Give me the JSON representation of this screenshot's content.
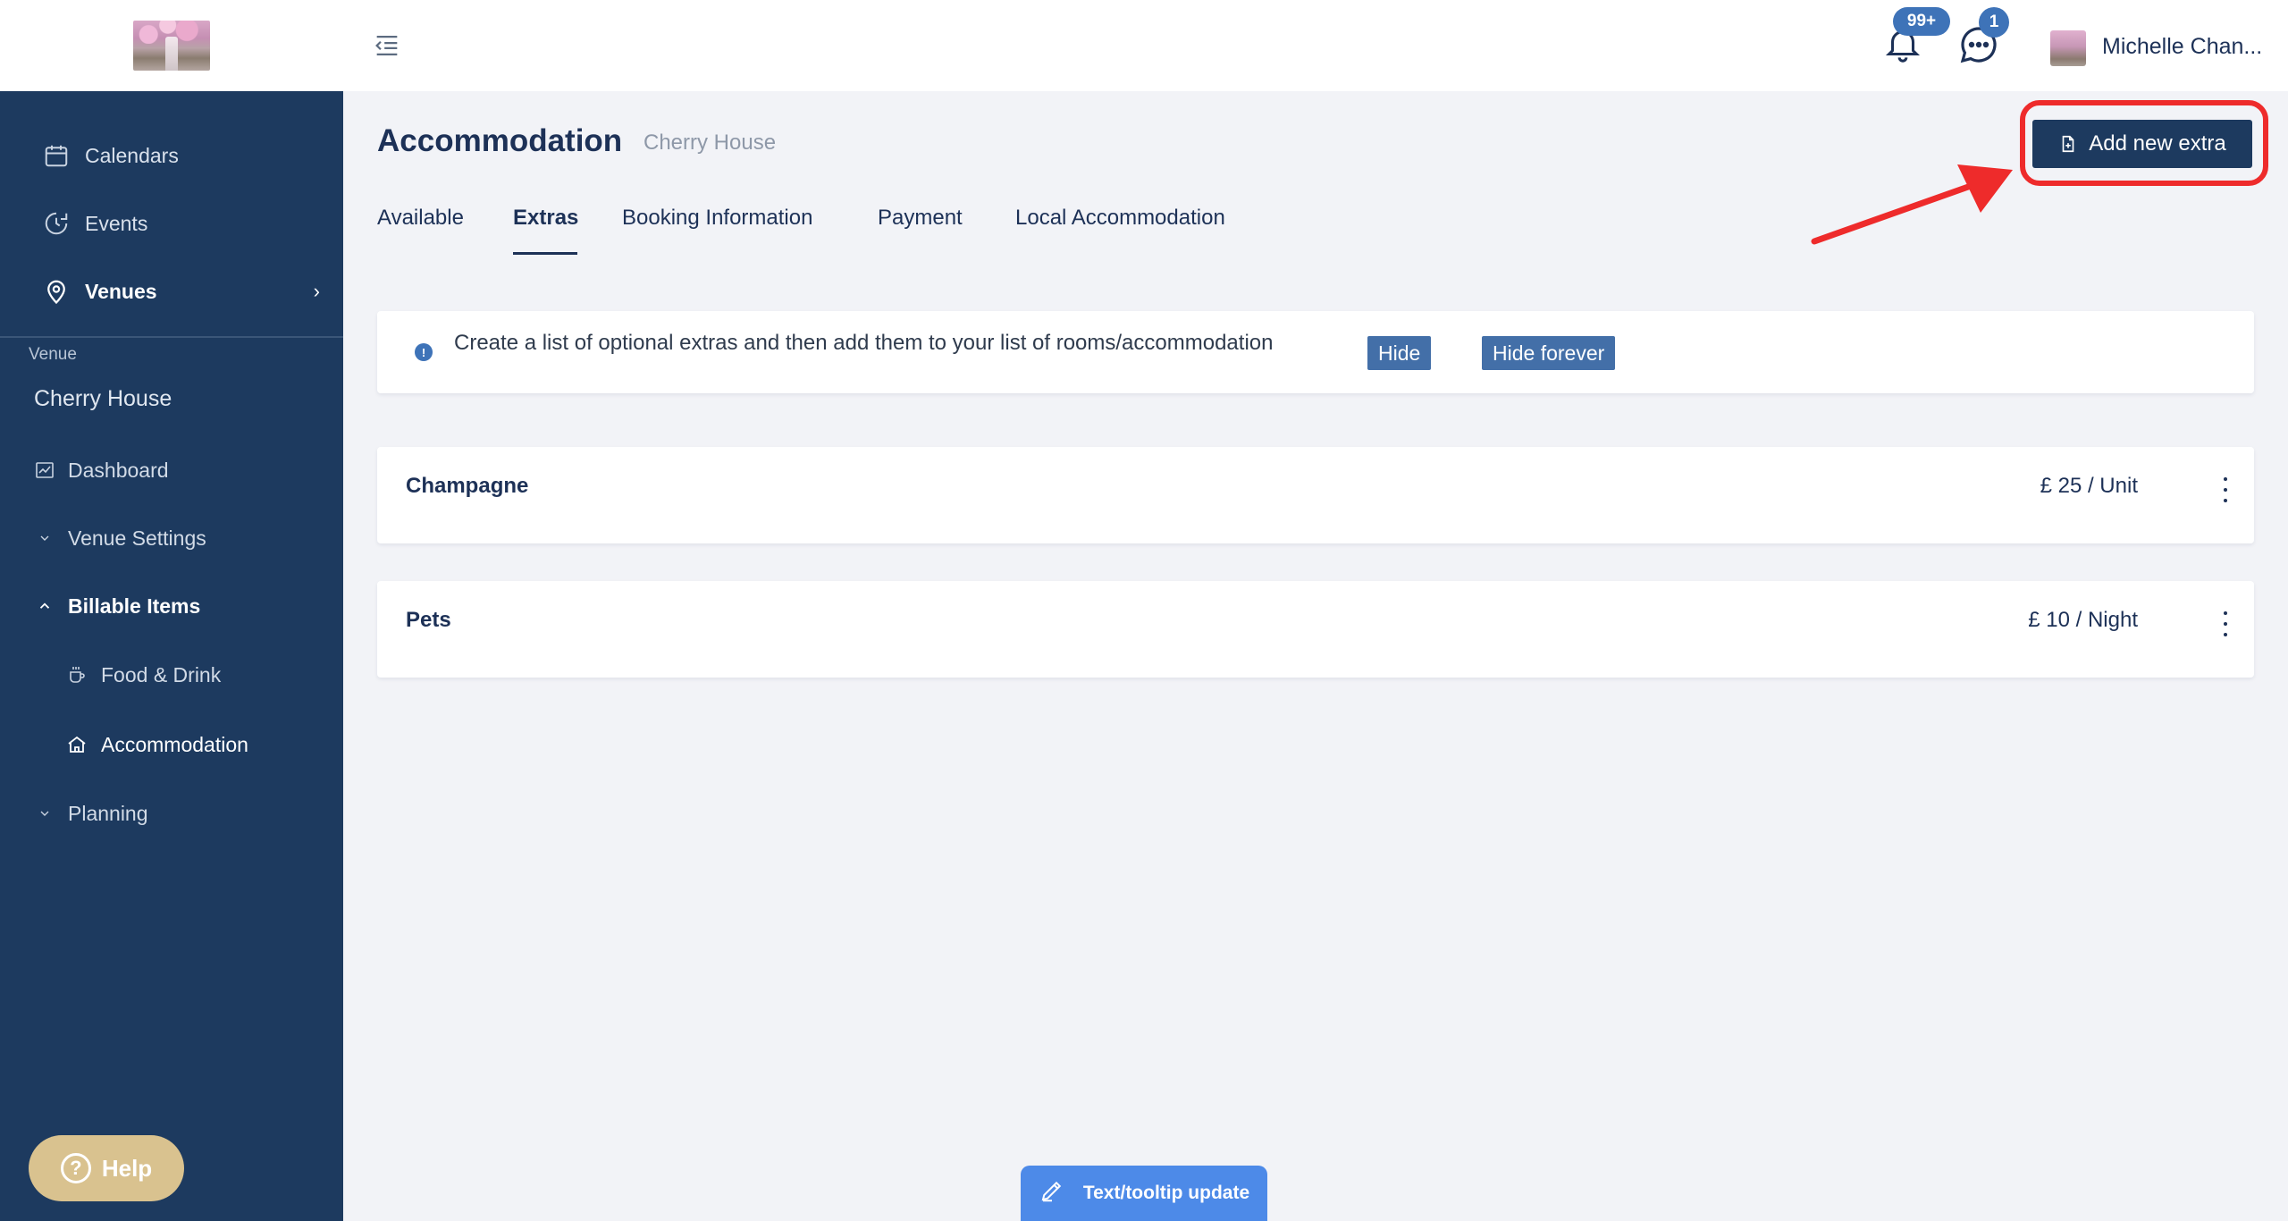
{
  "sidebar": {
    "nav": [
      {
        "label": "Calendars",
        "icon": "calendar-icon"
      },
      {
        "label": "Events",
        "icon": "events-icon"
      },
      {
        "label": "Venues",
        "icon": "location-pin-icon"
      }
    ],
    "venue_caption": "Venue",
    "venue_name": "Cherry House",
    "items": [
      {
        "label": "Dashboard",
        "icon": "chart-icon"
      },
      {
        "label": "Venue Settings",
        "icon": "chevron-down-icon"
      },
      {
        "label": "Billable Items",
        "icon": "chevron-up-icon"
      },
      {
        "label": "Food & Drink",
        "icon": "coffee-cup-icon"
      },
      {
        "label": "Accommodation",
        "icon": "home-icon"
      },
      {
        "label": "Planning",
        "icon": "chevron-down-icon"
      }
    ],
    "help_label": "Help"
  },
  "topbar": {
    "notifications_badge": "99+",
    "messages_badge": "1",
    "user_name": "Michelle Chan..."
  },
  "main": {
    "title": "Accommodation",
    "subtitle": "Cherry House",
    "add_button_label": "Add new extra",
    "tabs": [
      {
        "label": "Available"
      },
      {
        "label": "Extras",
        "active": true
      },
      {
        "label": "Booking Information"
      },
      {
        "label": "Payment"
      },
      {
        "label": "Local Accommodation"
      }
    ],
    "info": {
      "text": "Create a list of optional extras and then add them to your list of rooms/accommodation",
      "hide_label": "Hide",
      "hide_forever_label": "Hide forever"
    },
    "extras": [
      {
        "name": "Champagne",
        "price": "£ 25 / Unit"
      },
      {
        "name": "Pets",
        "price": "£ 10 / Night"
      }
    ]
  },
  "footer": {
    "tooltip_update_label": "Text/tooltip update"
  },
  "colors": {
    "sidebar_bg": "#1d3a5f",
    "accent_blue": "#3e73b8",
    "highlight_red": "#ee2b2b",
    "help_gold": "#d9c28f"
  }
}
